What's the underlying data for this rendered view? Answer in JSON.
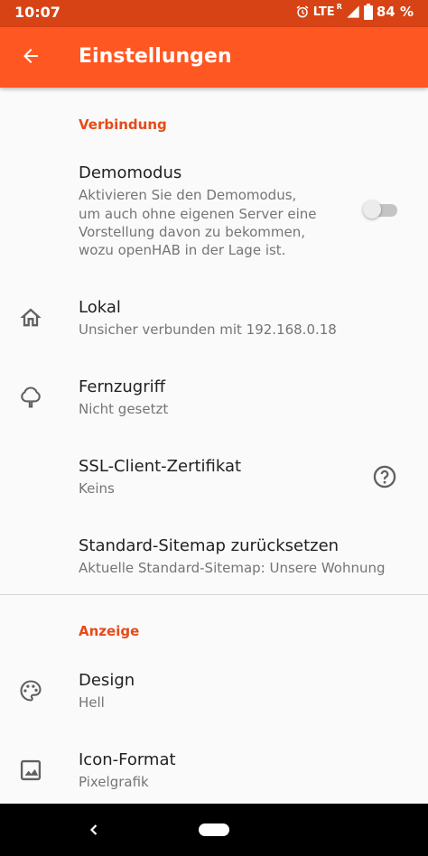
{
  "status_bar": {
    "time": "10:07",
    "network": "LTE",
    "roaming": "R",
    "battery": "84 %",
    "icons": [
      "alarm-icon",
      "signal-icon",
      "battery-icon"
    ]
  },
  "app_bar": {
    "title": "Einstellungen",
    "back_icon": "arrow-back-icon"
  },
  "sections": {
    "connection": "Verbindung",
    "display": "Anzeige"
  },
  "settings": {
    "demo": {
      "title": "Demomodus",
      "summary_lines": [
        "Aktivieren Sie den Demomodus,",
        "um auch ohne eigenen Server eine",
        "Vorstellung davon zu bekommen,",
        "wozu openHAB in der Lage ist."
      ],
      "enabled": false
    },
    "local": {
      "title": "Lokal",
      "summary": "Unsicher verbunden mit 192.168.0.18",
      "icon": "home-icon"
    },
    "remote": {
      "title": "Fernzugriff",
      "summary": "Nicht gesetzt",
      "icon": "tree-icon"
    },
    "ssl": {
      "title": "SSL-Client-Zertifikat",
      "summary": "Keins",
      "help_icon": "help-circle-icon"
    },
    "sitemap": {
      "title": "Standard-Sitemap zurücksetzen",
      "summary": "Aktuelle Standard-Sitemap: Unsere Wohnung"
    },
    "design": {
      "title": "Design",
      "summary": "Hell",
      "icon": "palette-icon"
    },
    "icon_format": {
      "title": "Icon-Format",
      "summary": "Pixelgrafik",
      "icon": "image-icon"
    }
  },
  "colors": {
    "status_bar": "#d84315",
    "app_bar": "#ff5722",
    "section_header": "#e64a19",
    "background": "#fafafa"
  },
  "nav_bar": {
    "icons": [
      "nav-back-icon",
      "nav-home-pill"
    ]
  }
}
